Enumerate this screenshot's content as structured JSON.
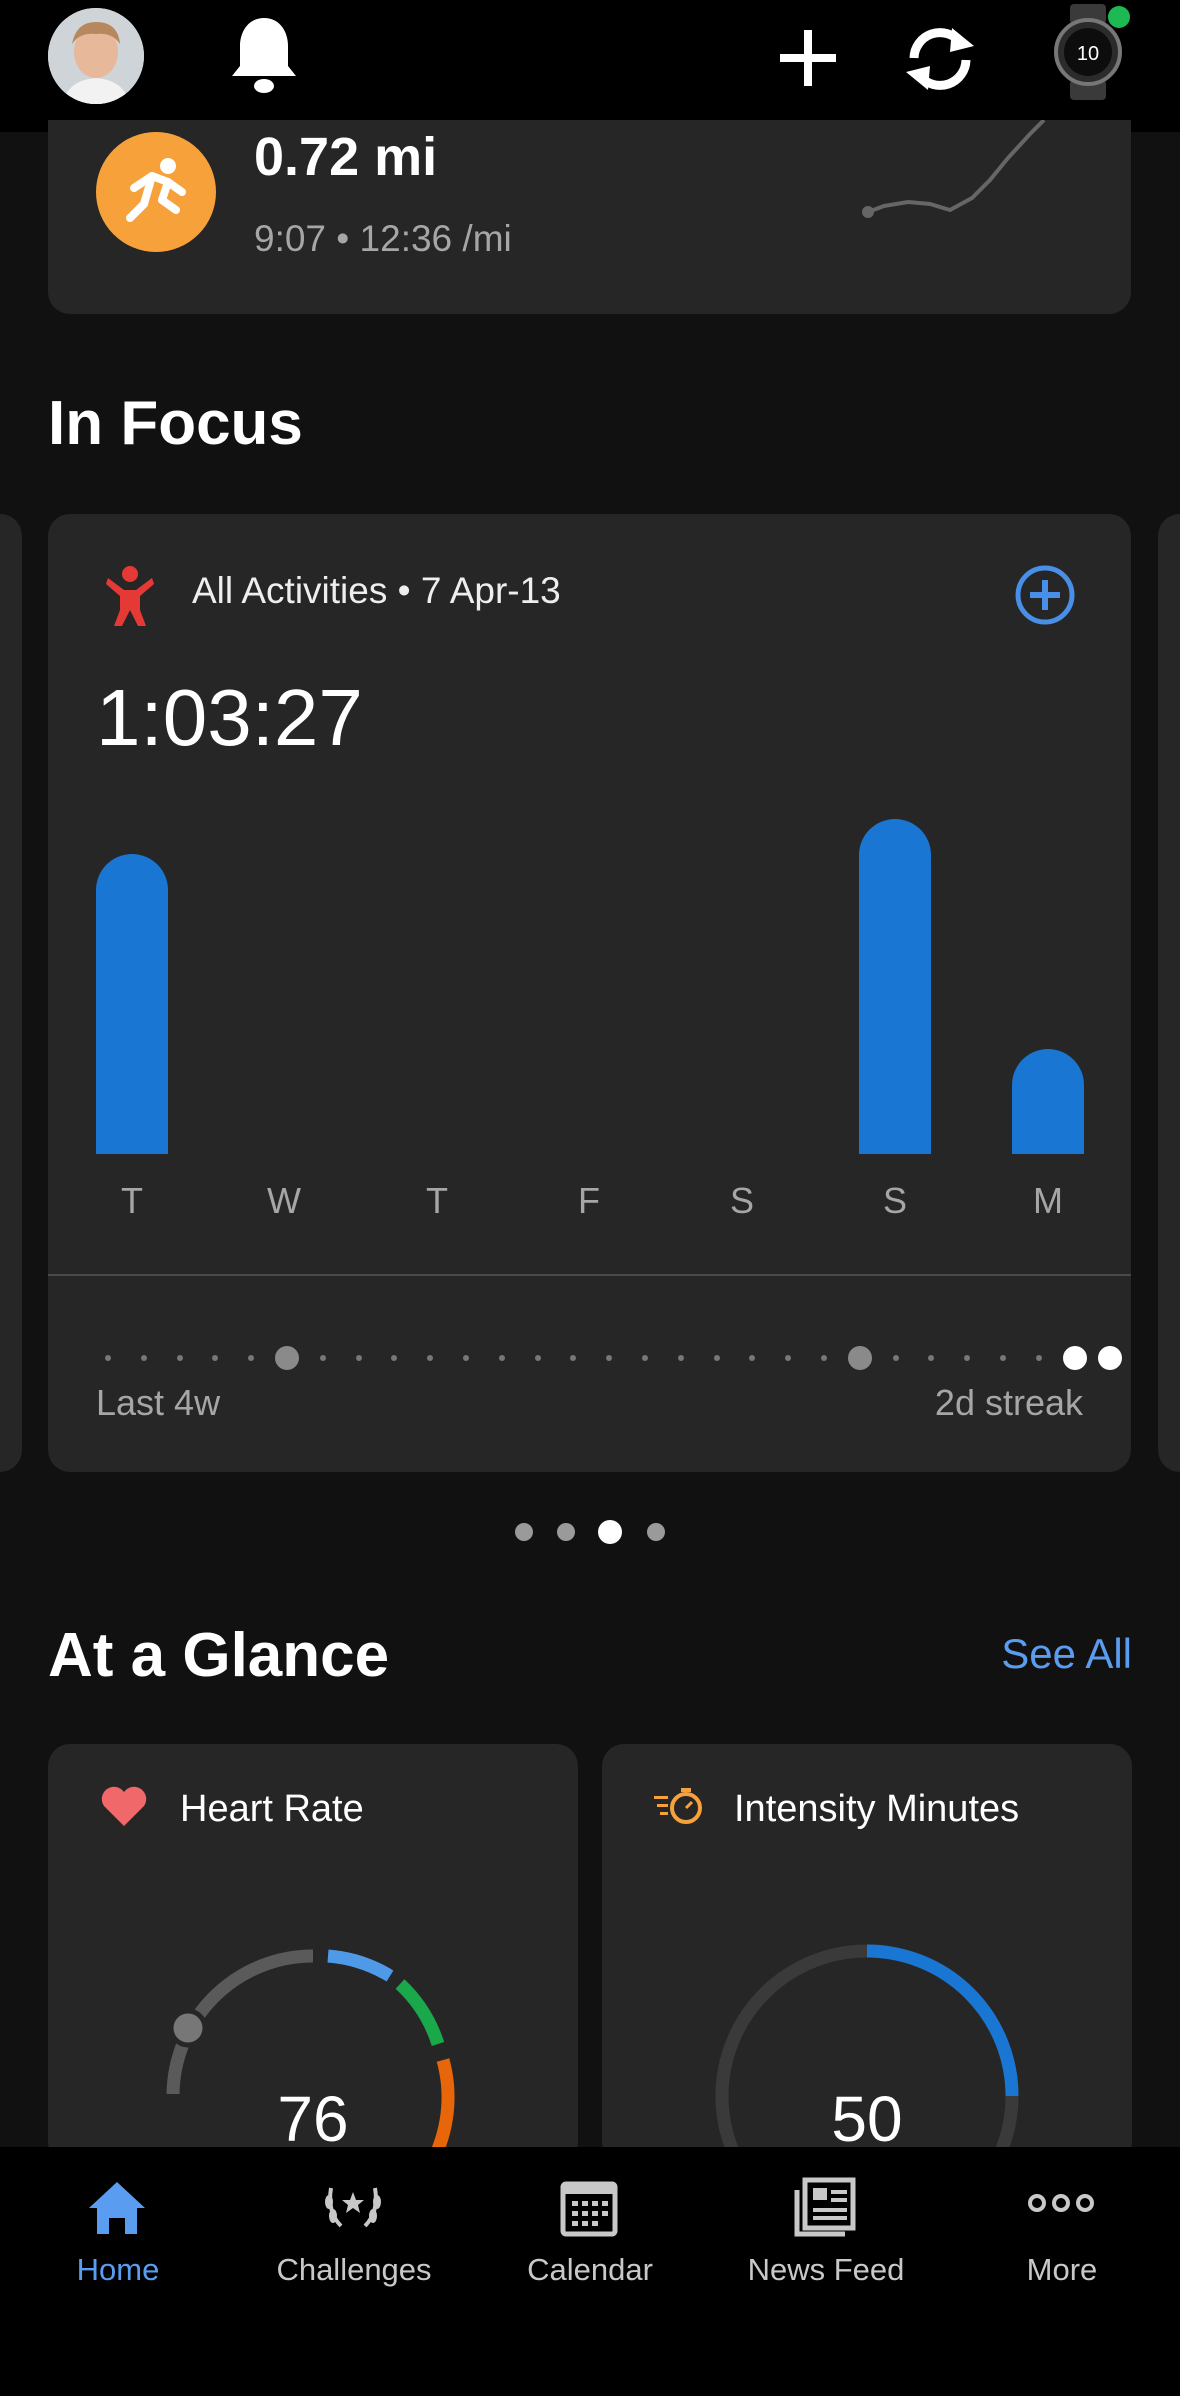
{
  "recent_activity": {
    "distance": "0.72 mi",
    "duration": "9:07",
    "pace": "12:36 /mi",
    "separator": "•"
  },
  "in_focus": {
    "title": "In Focus",
    "card": {
      "activity_label": "All Activities",
      "separator": "•",
      "date_range": "7 Apr-13",
      "total_time": "1:03:27",
      "days": [
        "T",
        "W",
        "T",
        "F",
        "S",
        "S",
        "M"
      ],
      "bar_fractions": [
        0.6,
        0,
        0,
        0,
        0,
        0.67,
        0.21
      ],
      "streak_left": "Last 4w",
      "streak_right": "2d streak"
    },
    "page_indicator": {
      "count": 4,
      "active_index": 2
    }
  },
  "at_a_glance": {
    "title": "At a Glance",
    "see_all": "See All",
    "heart_rate": {
      "label": "Heart Rate",
      "value": "76"
    },
    "intensity": {
      "label": "Intensity Minutes",
      "value": "50",
      "progress": 0.5
    }
  },
  "bottom_nav": {
    "items": [
      {
        "label": "Home",
        "active": true
      },
      {
        "label": "Challenges",
        "active": false
      },
      {
        "label": "Calendar",
        "active": false
      },
      {
        "label": "News Feed",
        "active": false
      },
      {
        "label": "More",
        "active": false
      }
    ]
  },
  "colors": {
    "accent_blue": "#1976d2",
    "link_blue": "#5a9df0",
    "activity_orange": "#f7a13a",
    "heart_red": "#f0686a",
    "watch_status_green": "#1db954"
  },
  "icons": [
    "avatar",
    "bell-icon",
    "plus-icon",
    "sync-icon",
    "watch-icon",
    "running-icon",
    "person-icon",
    "add-circle-icon",
    "heart-icon",
    "stopwatch-icon",
    "home-icon",
    "laurel-icon",
    "calendar-icon",
    "newspaper-icon",
    "more-icon"
  ]
}
